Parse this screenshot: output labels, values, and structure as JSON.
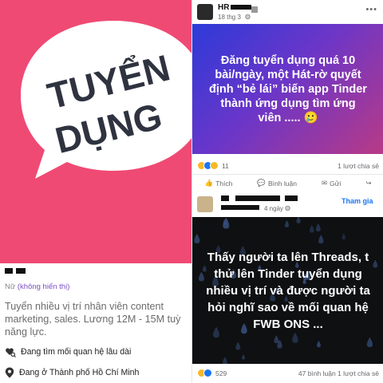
{
  "tinder": {
    "hero_line1": "TUYỂN",
    "hero_line2": "DỤNG",
    "gender": "Nữ",
    "gender_hidden": "(không hiển thị)",
    "bio": "Tuyển nhiều vị trí nhân viên content marketing, sales. Lương 12M - 15M tuỳ năng lực.",
    "looking_for": "Đang tìm mối quan hệ lâu dài",
    "location": "Đang ở Thành phố Hồ Chí Minh",
    "colors": {
      "hero": "#ef4a73",
      "bubble": "#ffffff",
      "text": "#2f3340"
    },
    "icons": [
      "heart-search-icon",
      "location-pin-icon"
    ]
  },
  "fb": {
    "post1": {
      "author": "HR",
      "date": "18 thg 3",
      "text": "Đăng tuyển dụng quá 10 bài/ngày, một Hát-rờ quyết định “bẻ lái” biến app Tinder thành ứng dụng tìm ứng viên .....",
      "emoji": "🥲",
      "reaction_count": "11",
      "shares": "1 lượt chia sẻ",
      "actions": {
        "like": "Thích",
        "comment": "Bình luận",
        "send": "Gửi"
      }
    },
    "post2": {
      "date": "4 ngày",
      "join_label": "Tham gia",
      "text": "Thấy người ta lên Threads, t thử lên Tinder tuyển dụng nhiều vị trí và được người ta hỏi nghĩ sao về mối quan hệ FWB ONS ...",
      "reaction_count": "529",
      "comments": "47 bình luận",
      "shares": "1 lượt chia sẻ"
    },
    "colors": {
      "post1_from": "#2d3ad8",
      "post1_to": "#b83a86",
      "post2_bg": "#0f1012",
      "link": "#1877f2"
    }
  }
}
